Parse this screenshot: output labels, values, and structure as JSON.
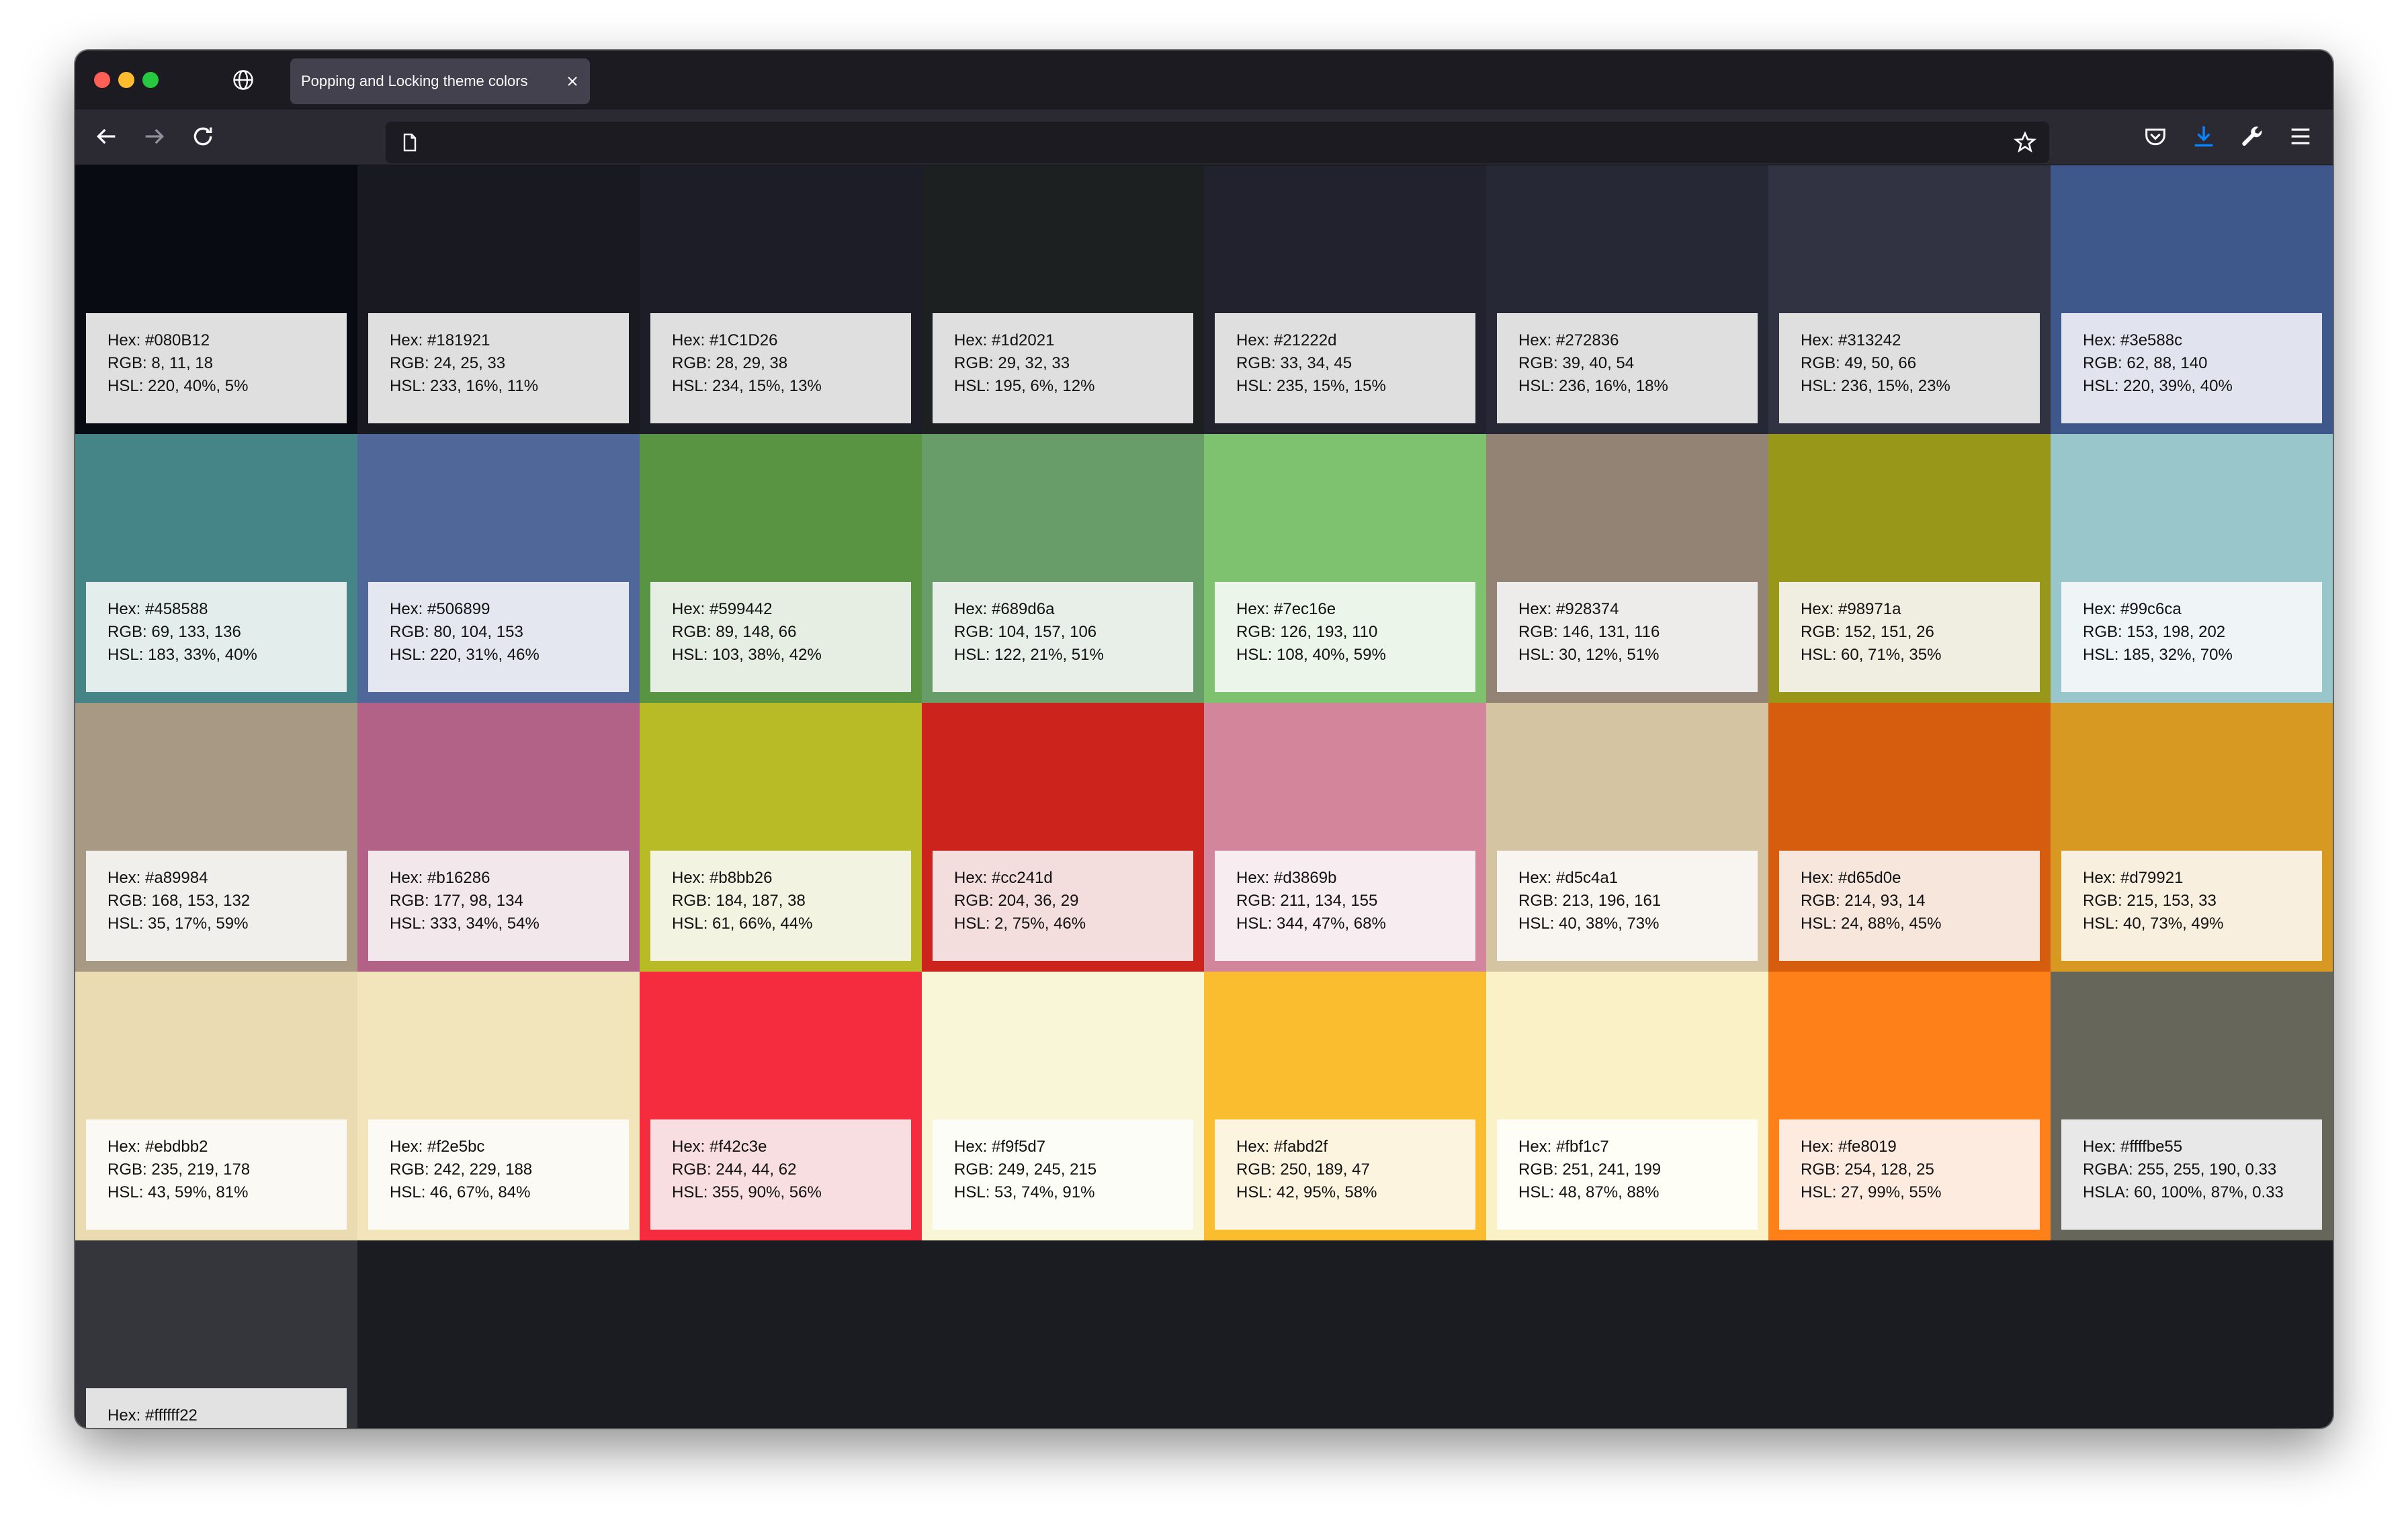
{
  "window": {
    "tab_title": "Popping and Locking theme colors",
    "url": ""
  },
  "icons": [
    "globe-icon",
    "close-icon",
    "back-icon",
    "forward-icon",
    "reload-icon",
    "page-icon",
    "bookmark-star-icon",
    "pocket-icon",
    "downloads-icon",
    "wrench-icon",
    "menu-icon"
  ],
  "colors": {
    "accent_download": "#0a84ff",
    "toolbar": "#2b2a33",
    "titlebar": "#1c1b22"
  },
  "swatches": [
    {
      "color": "#080B12",
      "card": "#dfdfe0",
      "hex": "Hex: #080B12",
      "rgb": "RGB: 8, 11, 18",
      "hsl": "HSL: 220, 40%, 5%"
    },
    {
      "color": "#181921",
      "card": "#dfdfe0",
      "hex": "Hex: #181921",
      "rgb": "RGB: 24, 25, 33",
      "hsl": "HSL: 233, 16%, 11%"
    },
    {
      "color": "#1C1D26",
      "card": "#dfdfe0",
      "hex": "Hex: #1C1D26",
      "rgb": "RGB: 28, 29, 38",
      "hsl": "HSL: 234, 15%, 13%"
    },
    {
      "color": "#1d2021",
      "card": "#dfdfe0",
      "hex": "Hex: #1d2021",
      "rgb": "RGB: 29, 32, 33",
      "hsl": "HSL: 195, 6%, 12%"
    },
    {
      "color": "#21222d",
      "card": "#dfdfe0",
      "hex": "Hex: #21222d",
      "rgb": "RGB: 33, 34, 45",
      "hsl": "HSL: 235, 15%, 15%"
    },
    {
      "color": "#272836",
      "card": "#dfdfe0",
      "hex": "Hex: #272836",
      "rgb": "RGB: 39, 40, 54",
      "hsl": "HSL: 236, 16%, 18%"
    },
    {
      "color": "#313242",
      "card": "#dfdfe0",
      "hex": "Hex: #313242",
      "rgb": "RGB: 49, 50, 66",
      "hsl": "HSL: 236, 15%, 23%"
    },
    {
      "color": "#3e588c",
      "card": "#e1e4ee",
      "hex": "Hex: #3e588c",
      "rgb": "RGB: 62, 88, 140",
      "hsl": "HSL: 220, 39%, 40%"
    },
    {
      "color": "#458588",
      "card": "#e3edec",
      "hex": "Hex: #458588",
      "rgb": "RGB: 69, 133, 136",
      "hsl": "HSL: 183, 33%, 40%"
    },
    {
      "color": "#506899",
      "card": "#e4e7f0",
      "hex": "Hex: #506899",
      "rgb": "RGB: 80, 104, 153",
      "hsl": "HSL: 220, 31%, 46%"
    },
    {
      "color": "#599442",
      "card": "#e6eee3",
      "hex": "Hex: #599442",
      "rgb": "RGB: 89, 148, 66",
      "hsl": "HSL: 103, 38%, 42%"
    },
    {
      "color": "#689d6a",
      "card": "#e8efe8",
      "hex": "Hex: #689d6a",
      "rgb": "RGB: 104, 157, 106",
      "hsl": "HSL: 122, 21%, 51%"
    },
    {
      "color": "#7ec16e",
      "card": "#ecf5ea",
      "hex": "Hex: #7ec16e",
      "rgb": "RGB: 126, 193, 110",
      "hsl": "HSL: 108, 40%, 59%"
    },
    {
      "color": "#928374",
      "card": "#eeecea",
      "hex": "Hex: #928374",
      "rgb": "RGB: 146, 131, 116",
      "hsl": "HSL: 30, 12%, 51%"
    },
    {
      "color": "#98971a",
      "card": "#efeee0",
      "hex": "Hex: #98971a",
      "rgb": "RGB: 152, 151, 26",
      "hsl": "HSL: 60, 71%, 35%"
    },
    {
      "color": "#99c6ca",
      "card": "#eff5f6",
      "hex": "Hex: #99c6ca",
      "rgb": "RGB: 153, 198, 202",
      "hsl": "HSL: 185, 32%, 70%"
    },
    {
      "color": "#a89984",
      "card": "#f1efec",
      "hex": "Hex: #a89984",
      "rgb": "RGB: 168, 153, 132",
      "hsl": "HSL: 35, 17%, 59%"
    },
    {
      "color": "#b16286",
      "card": "#f2e8ec",
      "hex": "Hex: #b16286",
      "rgb": "RGB: 177, 98, 134",
      "hsl": "HSL: 333, 34%, 54%"
    },
    {
      "color": "#b8bb26",
      "card": "#f3f3e2",
      "hex": "Hex: #b8bb26",
      "rgb": "RGB: 184, 187, 38",
      "hsl": "HSL: 61, 66%, 44%"
    },
    {
      "color": "#cc241d",
      "card": "#f4dddd",
      "hex": "Hex: #cc241d",
      "rgb": "RGB: 204, 36, 29",
      "hsl": "HSL: 2, 75%, 46%"
    },
    {
      "color": "#d3869b",
      "card": "#f7edf0",
      "hex": "Hex: #d3869b",
      "rgb": "RGB: 211, 134, 155",
      "hsl": "HSL: 344, 47%, 68%"
    },
    {
      "color": "#d5c4a1",
      "card": "#f8f5f0",
      "hex": "Hex: #d5c4a1",
      "rgb": "RGB: 213, 196, 161",
      "hsl": "HSL: 40, 38%, 73%"
    },
    {
      "color": "#d65d0e",
      "card": "#f6e6dc",
      "hex": "Hex: #d65d0e",
      "rgb": "RGB: 214, 93, 14",
      "hsl": "HSL: 24, 88%, 45%"
    },
    {
      "color": "#d79921",
      "card": "#f8efdf",
      "hex": "Hex: #d79921",
      "rgb": "RGB: 215, 153, 33",
      "hsl": "HSL: 40, 73%, 49%"
    },
    {
      "color": "#ebdbb2",
      "card": "#fbf9f3",
      "hex": "Hex: #ebdbb2",
      "rgb": "RGB: 235, 219, 178",
      "hsl": "HSL: 43, 59%, 81%"
    },
    {
      "color": "#f2e5bc",
      "card": "#fcfaf4",
      "hex": "Hex: #f2e5bc",
      "rgb": "RGB: 242, 229, 188",
      "hsl": "HSL: 46, 67%, 84%"
    },
    {
      "color": "#f42c3e",
      "card": "#f8dde1",
      "hex": "Hex: #f42c3e",
      "rgb": "RGB: 244, 44, 62",
      "hsl": "HSL: 355, 90%, 56%"
    },
    {
      "color": "#f9f5d7",
      "card": "#fdfdf8",
      "hex": "Hex: #f9f5d7",
      "rgb": "RGB: 249, 245, 215",
      "hsl": "HSL: 53, 74%, 91%"
    },
    {
      "color": "#fabd2f",
      "card": "#fdf4df",
      "hex": "Hex: #fabd2f",
      "rgb": "RGB: 250, 189, 47",
      "hsl": "HSL: 42, 95%, 58%"
    },
    {
      "color": "#fbf1c7",
      "card": "#fefdf6",
      "hex": "Hex: #fbf1c7",
      "rgb": "RGB: 251, 241, 199",
      "hsl": "HSL: 48, 87%, 88%"
    },
    {
      "color": "#fe8019",
      "card": "#fdebe0",
      "hex": "Hex: #fe8019",
      "rgb": "RGB: 254, 128, 25",
      "hsl": "HSL: 27, 99%, 55%"
    },
    {
      "color": "#66665a",
      "card": "#e8e8e8",
      "hex": "Hex: #ffffbe55",
      "rgb": "RGBA: 255, 255, 190, 0.33",
      "hsl": "HSLA: 60, 100%, 87%, 0.33"
    },
    {
      "color": "#35363b",
      "card": "#e2e2e3",
      "hex": "Hex: #ffffff22",
      "rgb": "",
      "hsl": ""
    }
  ]
}
